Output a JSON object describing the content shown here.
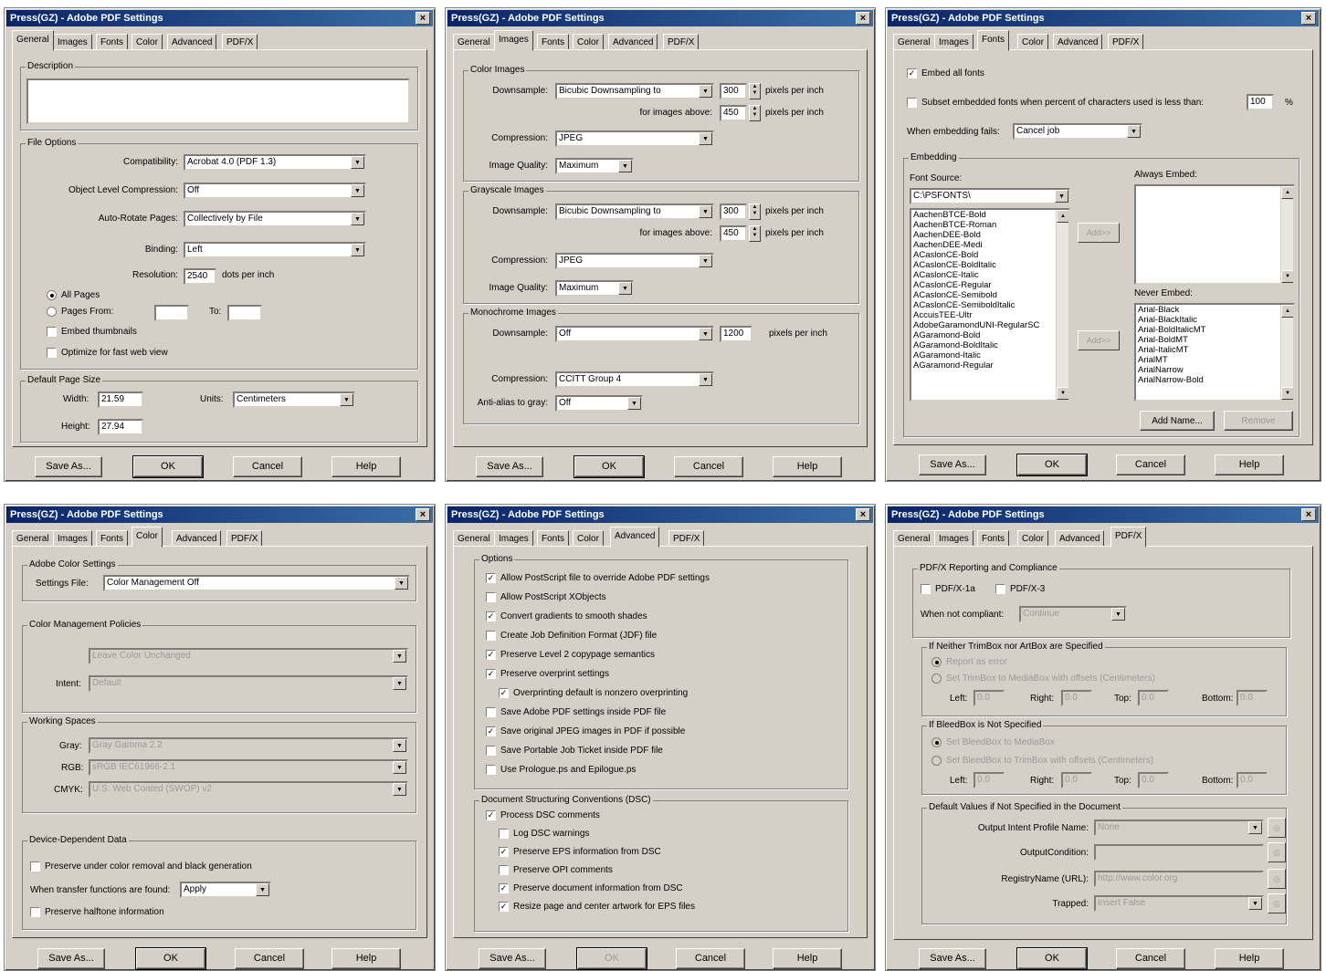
{
  "window_title": "Press(GZ) - Adobe PDF Settings",
  "close_glyph": "×",
  "tab_labels": {
    "general": "General",
    "images": "Images",
    "fonts": "Fonts",
    "color": "Color",
    "advanced": "Advanced",
    "pdfx": "PDF/X"
  },
  "buttons": {
    "save_as": "Save As...",
    "ok": "OK",
    "cancel": "Cancel",
    "help": "Help"
  },
  "general": {
    "description_label": "Description",
    "file_options_label": "File Options",
    "compatibility_label": "Compatibility:",
    "compatibility_value": "Acrobat 4.0 (PDF 1.3)",
    "object_compression_label": "Object Level Compression:",
    "object_compression_value": "Off",
    "auto_rotate_label": "Auto-Rotate Pages:",
    "auto_rotate_value": "Collectively by File",
    "binding_label": "Binding:",
    "binding_value": "Left",
    "resolution_label": "Resolution:",
    "resolution_value": "2540",
    "resolution_unit": "dots per inch",
    "all_pages": "All Pages",
    "pages_from": "Pages From:",
    "to": "To:",
    "embed_thumbnails": "Embed thumbnails",
    "optimize_web": "Optimize for fast web view",
    "page_size_label": "Default Page Size",
    "width_label": "Width:",
    "width_value": "21.59",
    "units_label": "Units:",
    "units_value": "Centimeters",
    "height_label": "Height:",
    "height_value": "27.94"
  },
  "images": {
    "color_label": "Color Images",
    "gray_label": "Grayscale Images",
    "mono_label": "Monochrome Images",
    "downsample_label": "Downsample:",
    "bicubic": "Bicubic Downsampling to",
    "off": "Off",
    "ppi": "pixels per inch",
    "for_images_above": "for images above:",
    "compression_label": "Compression:",
    "jpeg": "JPEG",
    "ccitt": "CCITT Group 4",
    "quality_label": "Image Quality:",
    "maximum": "Maximum",
    "antialias_label": "Anti-alias to gray:",
    "v300": "300",
    "v450": "450",
    "v1200": "1200"
  },
  "fonts": {
    "embed_all": "Embed all fonts",
    "subset": "Subset embedded fonts when percent of characters used is less than:",
    "subset_value": "100",
    "pct": "%",
    "when_fails_label": "When embedding fails:",
    "when_fails_value": "Cancel job",
    "embedding_label": "Embedding",
    "font_source_label": "Font Source:",
    "font_source_value": "C:\\PSFONTS\\",
    "font_list": [
      "AachenBTCE-Bold",
      "AachenBTCE-Roman",
      "AachenDEE-Bold",
      "AachenDEE-Medi",
      "ACaslonCE-Bold",
      "ACaslonCE-BoldItalic",
      "ACaslonCE-Italic",
      "ACaslonCE-Regular",
      "ACaslonCE-Semibold",
      "ACaslonCE-SemiboldItalic",
      "AccuisTEE-Ultr",
      "AdobeGaramondUNI-RegularSC",
      "AGaramond-Bold",
      "AGaramond-BoldItalic",
      "AGaramond-Italic",
      "AGaramond-Regular"
    ],
    "add_btn": "Add>>",
    "remove_btn_mid": "Add>>",
    "always_embed_label": "Always Embed:",
    "never_embed_label": "Never Embed:",
    "never_list": [
      "Arial-Black",
      "Arial-BlackItalic",
      "Arial-BoldItalicMT",
      "Arial-BoldMT",
      "Arial-ItalicMT",
      "ArialMT",
      "ArialNarrow",
      "ArialNarrow-Bold"
    ],
    "add_name": "Add Name...",
    "remove": "Remove"
  },
  "color": {
    "adobe_settings_label": "Adobe Color Settings",
    "settings_file_label": "Settings File:",
    "settings_file_value": "Color Management Off",
    "policies_label": "Color Management Policies",
    "policy_value": "Leave Color Unchanged",
    "intent_label": "Intent:",
    "intent_value": "Default",
    "working_spaces_label": "Working Spaces",
    "gray_label": "Gray:",
    "gray_value": "Gray Gamma 2.2",
    "rgb_label": "RGB:",
    "rgb_value": "sRGB IEC61966-2.1",
    "cmyk_label": "CMYK:",
    "cmyk_value": "U.S. Web Coated (SWOP) v2",
    "device_label": "Device-Dependent Data",
    "preserve_ucr": "Preserve under color removal and black generation",
    "transfer_label": "When transfer functions are found:",
    "transfer_value": "Apply",
    "preserve_halftone": "Preserve halftone information"
  },
  "advanced": {
    "options_label": "Options",
    "options": [
      {
        "text": "Allow PostScript file to override Adobe PDF settings",
        "checked": true
      },
      {
        "text": "Allow PostScript XObjects",
        "checked": false
      },
      {
        "text": "Convert gradients to smooth shades",
        "checked": true
      },
      {
        "text": "Create Job Definition Format (JDF) file",
        "checked": false
      },
      {
        "text": "Preserve Level 2 copypage semantics",
        "checked": true
      },
      {
        "text": "Preserve overprint settings",
        "checked": true
      },
      {
        "text": "Overprinting default is nonzero overprinting",
        "checked": true
      },
      {
        "text": "Save Adobe PDF settings inside PDF file",
        "checked": false
      },
      {
        "text": "Save original JPEG images in PDF if possible",
        "checked": true
      },
      {
        "text": "Save Portable Job Ticket inside PDF file",
        "checked": false
      },
      {
        "text": "Use Prologue.ps and Epilogue.ps",
        "checked": false
      }
    ],
    "dsc_label": "Document Structuring Conventions (DSC)",
    "dsc": [
      {
        "text": "Process DSC comments",
        "checked": true
      },
      {
        "text": "Log DSC warnings",
        "checked": false
      },
      {
        "text": "Preserve EPS information from DSC",
        "checked": true
      },
      {
        "text": "Preserve OPI comments",
        "checked": false
      },
      {
        "text": "Preserve document information from DSC",
        "checked": true
      },
      {
        "text": "Resize page and center artwork for EPS files",
        "checked": true
      }
    ]
  },
  "pdfx": {
    "reporting_label": "PDF/X Reporting and Compliance",
    "x1a": "PDF/X-1a",
    "x3": "PDF/X-3",
    "not_compliant_label": "When not compliant:",
    "not_compliant_value": "Continue",
    "trim_label": "If Neither TrimBox nor ArtBox are Specified",
    "report_error": "Report as error",
    "set_trim": "Set TrimBox to MediaBox with offsets (Centimeters)",
    "bleed_label": "If BleedBox is Not Specified",
    "set_bleed_media": "Set BleedBox to MediaBox",
    "set_bleed_trim": "Set BleedBox to TrimBox with offsets (Centimeters)",
    "left": "Left:",
    "right": "Right:",
    "top": "Top:",
    "bottom": "Bottom:",
    "zero": "0.0",
    "defaults_label": "Default Values if Not Specified in the Document",
    "output_intent_label": "Output Intent Profile Name:",
    "output_intent_value": "None",
    "output_condition_label": "OutputCondition:",
    "output_condition_value": "",
    "registry_label": "RegistryName (URL):",
    "registry_value": "http://www.color.org",
    "trapped_label": "Trapped:",
    "trapped_value": "Insert False"
  }
}
